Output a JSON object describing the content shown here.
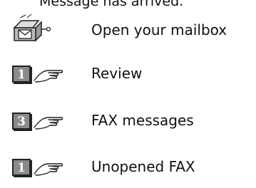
{
  "header": {
    "text": "Message has arrived."
  },
  "rows": [
    {
      "icon": "mailbox-icon",
      "label": "Open your mailbox"
    },
    {
      "icon": "key-1-hand-icon",
      "key": "1",
      "label": "Review"
    },
    {
      "icon": "key-3-hand-icon",
      "key": "3",
      "label": "FAX messages"
    },
    {
      "icon": "key-1-hand-icon",
      "key": "1",
      "label": "Unopened FAX"
    }
  ]
}
